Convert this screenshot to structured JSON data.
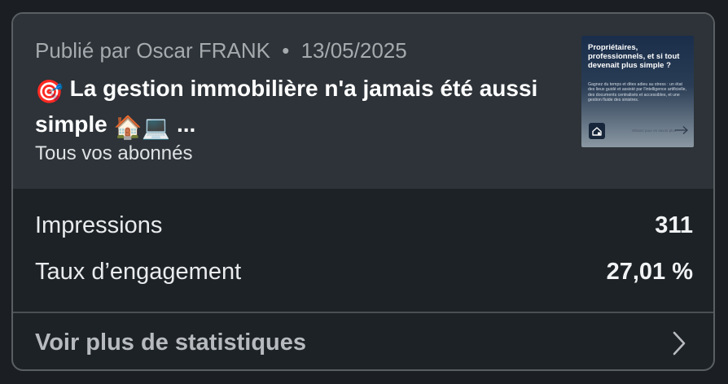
{
  "post": {
    "published_prefix": "Publié par",
    "author": "Oscar FRANK",
    "separator": "•",
    "date": "13/05/2025",
    "title_text": "La gestion immobilière n'a jamais été aussi simple",
    "title_emoji_start": "🎯",
    "title_emojis_end": "🏠💻",
    "title_ellipsis": "...",
    "audience": "Tous vos abonnés",
    "thumbnail": {
      "headline": "Propriétaires, professionnels, et si tout devenait plus simple ?",
      "body": "Gagnez du temps et dites adieu au stress : un état des lieux guidé et assisté par l'intelligence artificielle, des documents centralisés et accessibles, et une gestion fluide des sinistres.",
      "cta": "Glissez pour en savoir plus",
      "logo_icon": "house-logo-icon",
      "arrow_icon": "arrow-right-icon"
    }
  },
  "stats": {
    "impressions_label": "Impressions",
    "impressions_value": "311",
    "engagement_label": "Taux d’engagement",
    "engagement_value": "27,01 %"
  },
  "footer": {
    "more_label": "Voir plus de statistiques",
    "chevron_icon": "chevron-right-icon"
  },
  "colors": {
    "background": "#1b1f23",
    "card_top": "#2d3338",
    "card_bottom": "#1d2226",
    "border": "#5a5f64",
    "text_primary": "#ffffff",
    "text_secondary": "#a5aaae"
  }
}
